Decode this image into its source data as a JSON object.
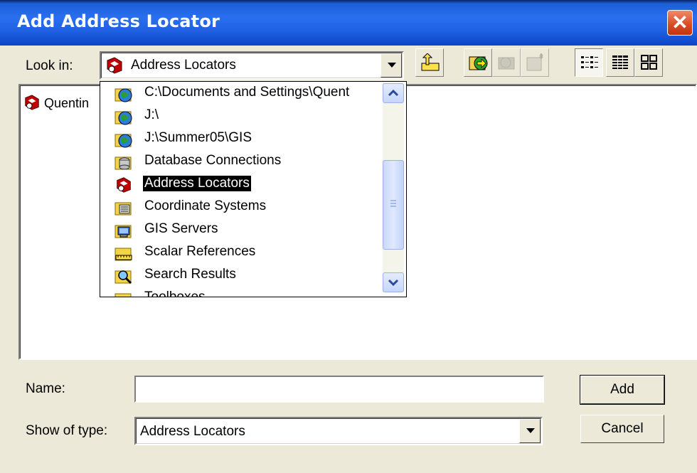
{
  "window": {
    "title": "Add Address Locator"
  },
  "look_in": {
    "label": "Look in:",
    "value": "Address Locators"
  },
  "toolbar": {
    "up_icon": "up-one-level-icon",
    "connect_icon": "connect-to-folder-icon",
    "disconnect_icon": "disconnect-folder-icon",
    "new_icon": "new-item-icon",
    "list_view_icon": "list-view-icon",
    "details_view_icon": "details-view-icon",
    "thumbnails_view_icon": "thumbnails-view-icon"
  },
  "file_list": {
    "items": [
      {
        "label": "Quentin",
        "icon": "address-locator-icon"
      }
    ]
  },
  "dropdown": {
    "items": [
      {
        "label": "C:\\Documents and Settings\\Quent",
        "icon": "folder-connection-icon"
      },
      {
        "label": "J:\\",
        "icon": "folder-connection-icon"
      },
      {
        "label": "J:\\Summer05\\GIS",
        "icon": "folder-connection-icon"
      },
      {
        "label": "Database Connections",
        "icon": "database-connections-icon"
      },
      {
        "label": "Address Locators",
        "icon": "address-locator-icon",
        "selected": true
      },
      {
        "label": "Coordinate Systems",
        "icon": "coordinate-systems-icon"
      },
      {
        "label": "GIS Servers",
        "icon": "gis-servers-icon"
      },
      {
        "label": "Scalar References",
        "icon": "scalar-references-icon"
      },
      {
        "label": "Search Results",
        "icon": "search-results-icon"
      },
      {
        "label": "Toolboxes",
        "icon": "toolboxes-icon"
      }
    ]
  },
  "name_field": {
    "label": "Name:",
    "value": ""
  },
  "type_field": {
    "label": "Show of type:",
    "value": "Address Locators"
  },
  "buttons": {
    "add": "Add",
    "cancel": "Cancel"
  },
  "colors": {
    "titlebar": "#2a6ff0",
    "dialog_bg": "#ece9d8",
    "selection": "#000000"
  }
}
